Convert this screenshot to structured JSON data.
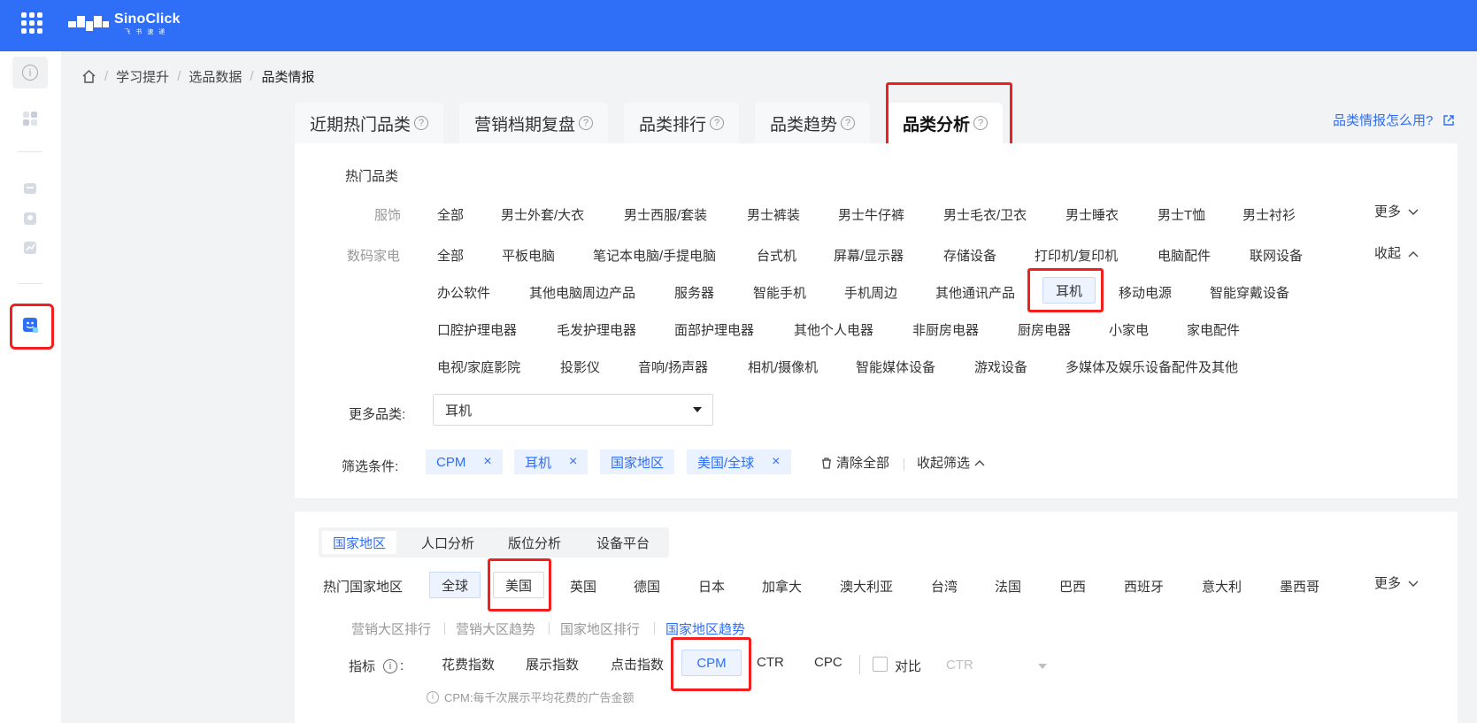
{
  "topbar": {
    "brand": "SinoClick",
    "brand_sub": "飞书速递"
  },
  "breadcrumb": [
    "学习提升",
    "选品数据",
    "品类情报"
  ],
  "tabs": [
    {
      "label": "近期热门品类"
    },
    {
      "label": "营销档期复盘"
    },
    {
      "label": "品类排行"
    },
    {
      "label": "品类趋势"
    },
    {
      "label": "品类分析",
      "active": true
    }
  ],
  "help_link": "品类情报怎么用?",
  "hot_category": {
    "title": "热门品类",
    "apparel": {
      "label": "服饰",
      "items": [
        "全部",
        "男士外套/大衣",
        "男士西服/套装",
        "男士裤装",
        "男士牛仔裤",
        "男士毛衣/卫衣",
        "男士睡衣",
        "男士T恤",
        "男士衬衫"
      ],
      "more": "更多"
    },
    "digital": {
      "label": "数码家电",
      "row1": [
        "全部",
        "平板电脑",
        "笔记本电脑/手提电脑",
        "台式机",
        "屏幕/显示器",
        "存储设备",
        "打印机/复印机",
        "电脑配件",
        "联网设备"
      ],
      "row2": [
        "办公软件",
        "其他电脑周边产品",
        "服务器",
        "智能手机",
        "手机周边",
        "其他通讯产品",
        "耳机",
        "移动电源",
        "智能穿戴设备"
      ],
      "row3": [
        "口腔护理电器",
        "毛发护理电器",
        "面部护理电器",
        "其他个人电器",
        "非厨房电器",
        "厨房电器",
        "小家电",
        "家电配件"
      ],
      "row4": [
        "电视/家庭影院",
        "投影仪",
        "音响/扬声器",
        "相机/摄像机",
        "智能媒体设备",
        "游戏设备",
        "多媒体及娱乐设备配件及其他"
      ],
      "collapse": "收起",
      "selected": "耳机"
    }
  },
  "more_category": {
    "label": "更多品类:",
    "value": "耳机"
  },
  "filters": {
    "label": "筛选条件:",
    "tags": [
      "CPM",
      "耳机",
      "国家地区",
      "美国/全球"
    ],
    "clear_all": "清除全部",
    "collapse": "收起筛选"
  },
  "subtabs": [
    {
      "label": "国家地区",
      "active": true
    },
    {
      "label": "人口分析"
    },
    {
      "label": "版位分析"
    },
    {
      "label": "设备平台"
    }
  ],
  "countries": {
    "label": "热门国家地区",
    "items": [
      "全球",
      "美国",
      "英国",
      "德国",
      "日本",
      "加拿大",
      "澳大利亚",
      "台湾",
      "法国",
      "巴西",
      "西班牙",
      "意大利",
      "墨西哥"
    ],
    "more": "更多"
  },
  "views": [
    "营销大区排行",
    "营销大区趋势",
    "国家地区排行",
    "国家地区趋势"
  ],
  "metrics": {
    "label": "指标",
    "items": [
      "花费指数",
      "展示指数",
      "点击指数",
      "CPM",
      "CTR",
      "CPC"
    ],
    "compare_label": "对比",
    "compare_value": "CTR",
    "hint": "CPM:每千次展示平均花费的广告金额"
  }
}
